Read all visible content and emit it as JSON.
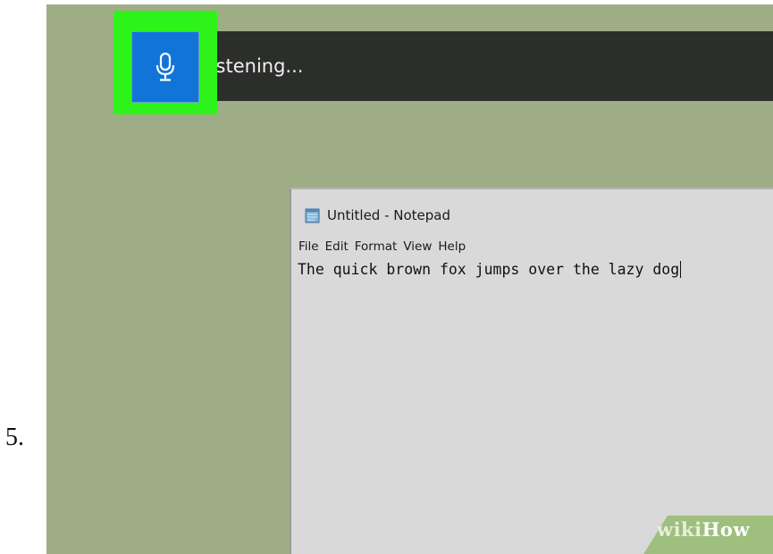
{
  "step": {
    "number": "5."
  },
  "dictation": {
    "status_text": "Listening...",
    "mic_icon": "microphone-icon",
    "colors": {
      "highlight": "#2ef31b",
      "mic_button": "#1175d8",
      "bar": "#2c2e2b"
    }
  },
  "notepad": {
    "icon": "notepad-icon",
    "title": "Untitled - Notepad",
    "menu": [
      {
        "label": "File"
      },
      {
        "label": "Edit"
      },
      {
        "label": "Format"
      },
      {
        "label": "View"
      },
      {
        "label": "Help"
      }
    ],
    "content": "The quick brown fox jumps over the lazy dog"
  },
  "watermark": {
    "part1": "wiki",
    "part2": "How"
  },
  "colors": {
    "desktop": "#9ead86",
    "notepad_background": "#d9d9d9"
  }
}
